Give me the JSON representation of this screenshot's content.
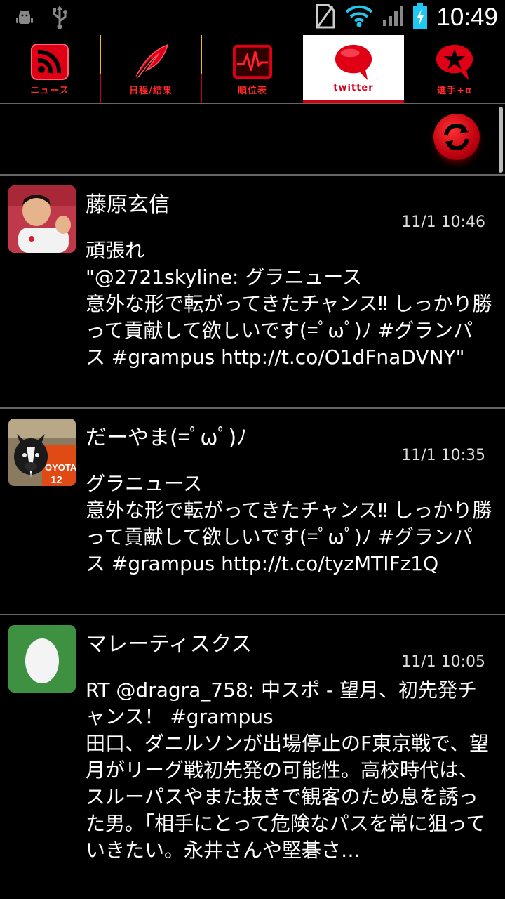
{
  "status_bar": {
    "time": "10:49",
    "left_icons": [
      "android-debug-icon",
      "usb-icon"
    ],
    "right_icons": [
      "no-sim-icon",
      "wifi-icon",
      "signal-icon",
      "battery-charging-icon"
    ]
  },
  "tabs": [
    {
      "label": "ニュース",
      "icon": "rss-icon",
      "active": false
    },
    {
      "label": "日程/結果",
      "icon": "quill-icon",
      "active": false
    },
    {
      "label": "順位表",
      "icon": "chart-icon",
      "active": false
    },
    {
      "label": "twitter",
      "icon": "speech-bubble-icon",
      "active": true
    },
    {
      "label": "選手+α",
      "icon": "star-bubble-icon",
      "active": false
    }
  ],
  "refresh": {
    "icon": "refresh-icon"
  },
  "tweets": [
    {
      "name": "藤原玄信",
      "time": "11/1 10:46",
      "text": "頑張れ\n\"@2721skyline: グラニュース\n意外な形で転がってきたチャンス‼ しっかり勝って貢献して欲しいです(=ﾟωﾟ)ﾉ #グランパス #grampus http://t.co/O1dFnaDVNY\""
    },
    {
      "name": "だーやま(=ﾟωﾟ)ﾉ",
      "time": "11/1 10:35",
      "text": "グラニュース\n意外な形で転がってきたチャンス‼ しっかり勝って貢献して欲しいです(=ﾟωﾟ)ﾉ #グランパス #grampus http://t.co/tyzMTIFz1Q"
    },
    {
      "name": "マレーティスクス",
      "time": "11/1 10:05",
      "text": "RT @dragra_758: 中スポ - 望月、初先発チャンス！ #grampus\n田口、ダニルソンが出場停止のF東京戦で、望月がリーグ戦初先発の可能性。高校時代は、スルーパスやまた抜きで観客のため息を誘った男。「相手にとって危険なパスを常に狙っていきたい。永井さんや堅碁さ…"
    }
  ],
  "colors": {
    "accent": "#d00018",
    "tab_separator": "#f0c000",
    "egg_avatar_bg": "#3d9140"
  }
}
